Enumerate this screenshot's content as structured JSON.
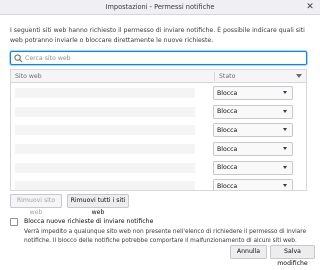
{
  "window": {
    "title": "Impostazioni - Permessi notifiche",
    "close_glyph": "✕"
  },
  "description": "I seguenti siti web hanno richiesto il permesso di inviare notifiche. È possibile indicare quali siti web potranno inviarle o bloccare direttamente le nuove richieste.",
  "search": {
    "placeholder": "Cerca sito web",
    "value": ""
  },
  "table": {
    "columns": [
      "Sito web",
      "Stato"
    ],
    "rows": [
      {
        "status": "Blocca"
      },
      {
        "status": "Blocca"
      },
      {
        "status": "Blocca"
      },
      {
        "status": "Blocca"
      },
      {
        "status": "Blocca"
      },
      {
        "status": "Blocca"
      }
    ]
  },
  "buttons": {
    "remove": "Rimuovi sito web",
    "remove_all": "Rimuovi tutti i siti web",
    "cancel": "Annulla",
    "save": "Salva modifiche"
  },
  "block_new": {
    "label": "Blocca nuove richieste di inviare notifiche",
    "description": "Verrà impedito a qualunque sito web non presente nell'elenco di richiedere il permesso di inviare notifiche. Il blocco delle notifiche potrebbe comportare il malfunzionamento di alcuni siti web.",
    "checked": false
  },
  "colors": {
    "accent": "#0a84ff"
  },
  "icons": {
    "search": "search-icon",
    "sort": "sort-arrow-icon",
    "dropdown": "chevron-down-icon"
  }
}
